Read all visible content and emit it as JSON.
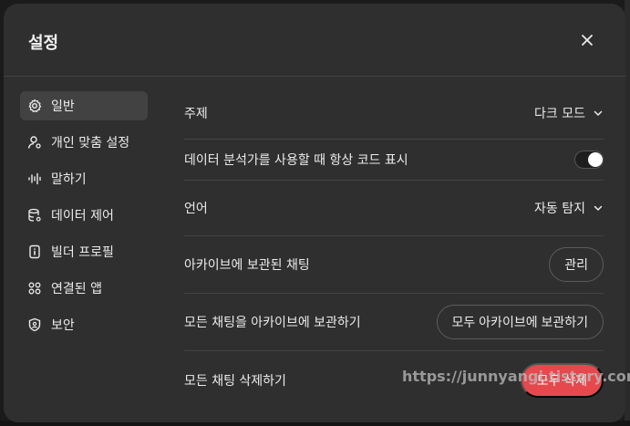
{
  "dialog": {
    "title": "설정"
  },
  "sidebar": {
    "items": [
      {
        "label": "일반",
        "icon": "gear-icon",
        "active": true
      },
      {
        "label": "개인 맞춤 설정",
        "icon": "person-settings-icon",
        "active": false
      },
      {
        "label": "말하기",
        "icon": "waveform-icon",
        "active": false
      },
      {
        "label": "데이터 제어",
        "icon": "database-icon",
        "active": false
      },
      {
        "label": "빌더 프로필",
        "icon": "id-card-icon",
        "active": false
      },
      {
        "label": "연결된 앱",
        "icon": "grid-apps-icon",
        "active": false
      },
      {
        "label": "보안",
        "icon": "shield-icon",
        "active": false
      }
    ]
  },
  "settings": {
    "theme": {
      "label": "주제",
      "value": "다크 모드"
    },
    "code_display": {
      "label": "데이터 분석가를 사용할 때 항상 코드 표시",
      "enabled": false
    },
    "language": {
      "label": "언어",
      "value": "자동 탐지"
    },
    "archived": {
      "label": "아카이브에 보관된 채팅",
      "button": "관리"
    },
    "archive_all": {
      "label": "모든 채팅을 아카이브에 보관하기",
      "button": "모두 아카이브에 보관하기"
    },
    "delete_all": {
      "label": "모든 채팅 삭제하기",
      "button": "모두 삭제"
    }
  },
  "watermark": "https://junnyangi.tistory.com",
  "colors": {
    "danger": "#e5484d",
    "dialog_bg": "#2f2f2f",
    "active_nav": "#424242"
  }
}
